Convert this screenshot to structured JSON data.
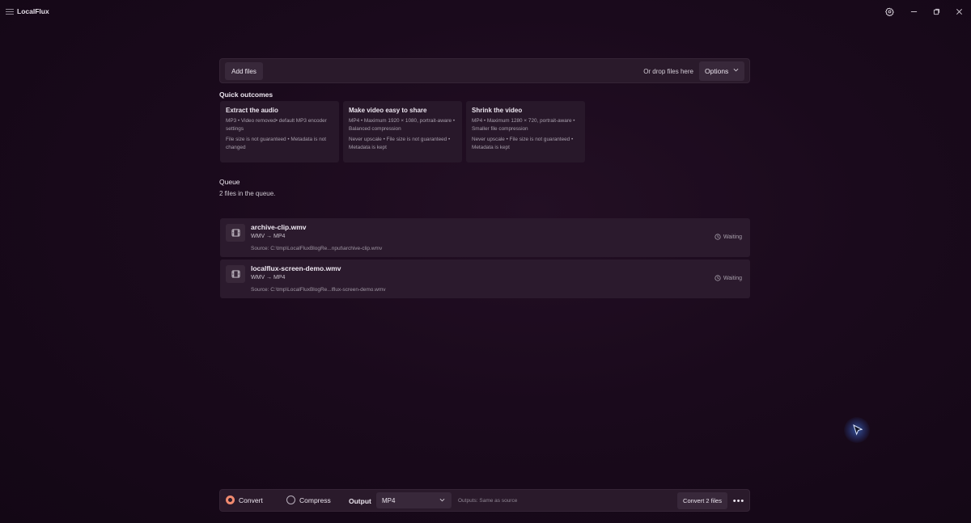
{
  "app": {
    "title": "LocalFlux"
  },
  "window": {
    "settings_icon": "gear-icon",
    "minimize_icon": "minimize-icon",
    "maximize_icon": "restore-icon",
    "close_icon": "close-icon"
  },
  "addbar": {
    "add_label": "Add files",
    "drop_text": "Or drop files here",
    "options_label": "Options"
  },
  "outcomes": {
    "heading": "Quick outcomes",
    "cards": [
      {
        "title": "Extract the audio",
        "line1": "MP3 • Video removed• default MP3 encoder settings",
        "line2": "File size is not guaranteed • Metadata is not changed"
      },
      {
        "title": "Make video easy to share",
        "line1": "MP4 • Maximum 1920 × 1080, portrait-aware • Balanced compression",
        "line2": "Never upscale • File size is not guaranteed • Metadata is kept"
      },
      {
        "title": "Shrink the video",
        "line1": "MP4 • Maximum 1280 × 720, portrait-aware • Smaller file compression",
        "line2": "Never upscale • File size is not guaranteed • Metadata is kept"
      }
    ]
  },
  "queue": {
    "heading": "Queue",
    "count_text": "2 files in the queue.",
    "items": [
      {
        "name": "archive-clip.wmv",
        "conversion": "WMV → MP4",
        "source": "Source: C:\\tmp\\LocalFluxBlogRe...nput\\archive-clip.wmv",
        "status": "Waiting"
      },
      {
        "name": "localflux-screen-demo.wmv",
        "conversion": "WMV → MP4",
        "source": "Source: C:\\tmp\\LocalFluxBlogRe...lflux-screen-demo.wmv",
        "status": "Waiting"
      }
    ]
  },
  "bottombar": {
    "mode_convert": "Convert",
    "mode_compress": "Compress",
    "selected_mode": "Convert",
    "output_label": "Output",
    "output_value": "MP4",
    "output_note": "Outputs: Same as source",
    "convert_button": "Convert 2 files",
    "more_label": "•••"
  },
  "colors": {
    "accent": "#f08a6f",
    "background": "#1a0a1c",
    "panel": "#2a1a2b"
  }
}
